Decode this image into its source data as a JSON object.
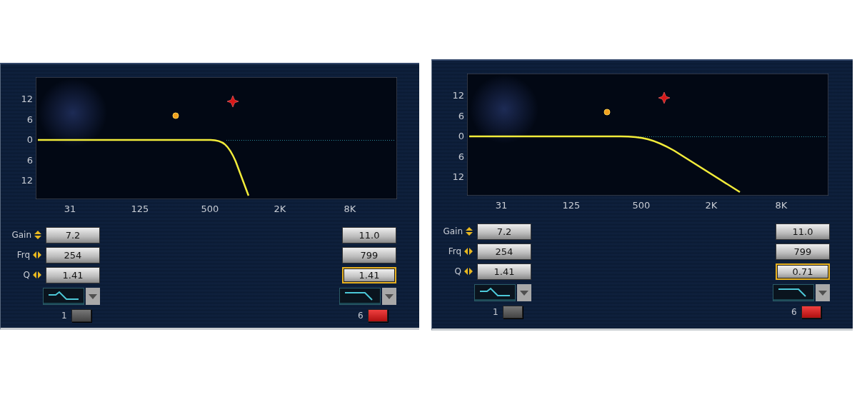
{
  "panels": [
    {
      "y_labels": [
        "12",
        "6",
        "0",
        "6",
        "12"
      ],
      "x_labels": [
        "31",
        "125",
        "500",
        "2K",
        "8K"
      ],
      "curve": {
        "kind": "steep"
      },
      "bands": [
        {
          "number": "1",
          "on": false,
          "filter": {
            "kind": "shelf"
          },
          "params": [
            {
              "label": "Gain",
              "kind": "vertical",
              "value": "7.2",
              "selected": false
            },
            {
              "label": "Frq",
              "kind": "horizontal",
              "value": "254",
              "selected": false
            },
            {
              "label": "Q",
              "kind": "horizontal",
              "value": "1.41",
              "selected": false
            }
          ]
        },
        {
          "number": "6",
          "on": true,
          "filter": {
            "kind": "lowpass"
          },
          "params": [
            {
              "value": "11.0",
              "selected": false
            },
            {
              "value": "799",
              "selected": false
            },
            {
              "value": "1.41",
              "selected": true
            }
          ]
        }
      ]
    },
    {
      "y_labels": [
        "12",
        "6",
        "0",
        "6",
        "12"
      ],
      "x_labels": [
        "31",
        "125",
        "500",
        "2K",
        "8K"
      ],
      "curve": {
        "kind": "gentle"
      },
      "bands": [
        {
          "number": "1",
          "on": false,
          "filter": {
            "kind": "shelf"
          },
          "params": [
            {
              "label": "Gain",
              "kind": "vertical",
              "value": "7.2",
              "selected": false
            },
            {
              "label": "Frq",
              "kind": "horizontal",
              "value": "254",
              "selected": false
            },
            {
              "label": "Q",
              "kind": "horizontal",
              "value": "1.41",
              "selected": false
            }
          ]
        },
        {
          "number": "6",
          "on": true,
          "filter": {
            "kind": "lowpass"
          },
          "params": [
            {
              "value": "11.0",
              "selected": false
            },
            {
              "value": "799",
              "selected": false
            },
            {
              "value": "0.71",
              "selected": true
            }
          ]
        }
      ]
    }
  ]
}
